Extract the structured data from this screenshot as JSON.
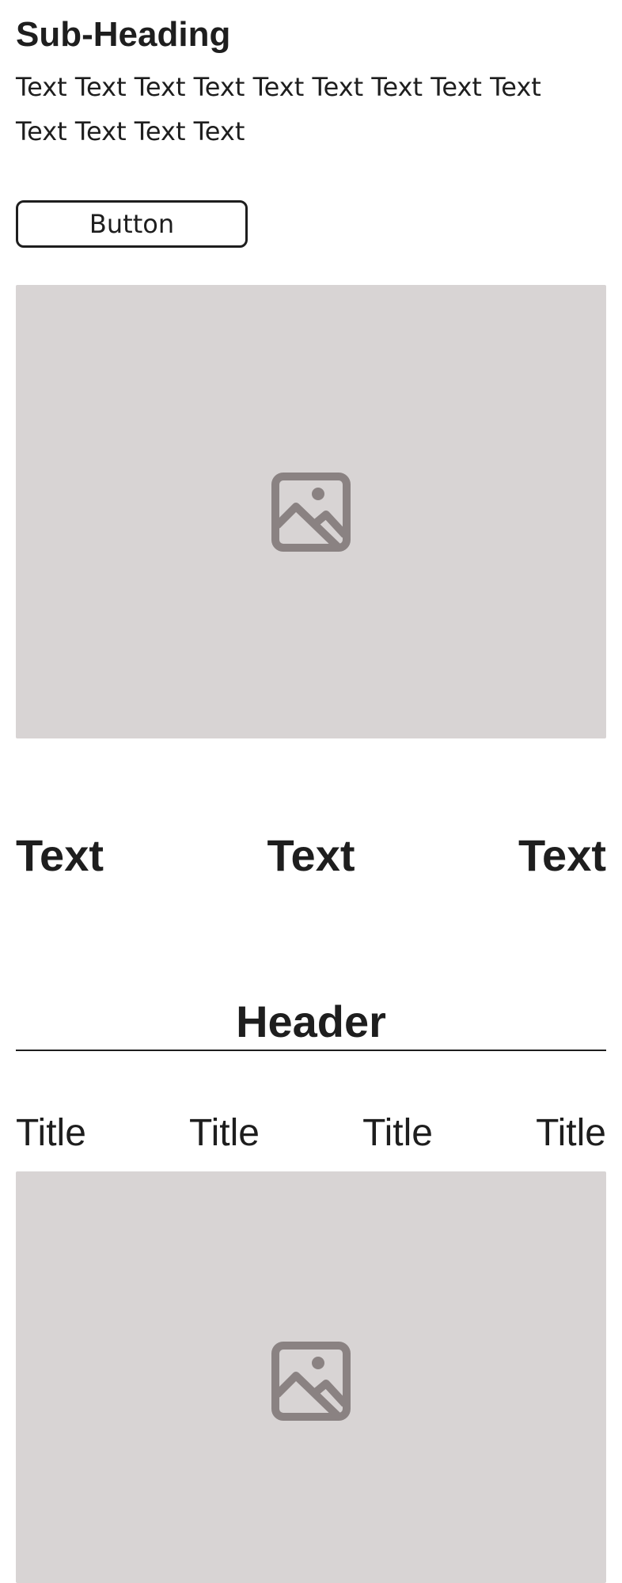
{
  "section": {
    "subheading": "Sub-Heading",
    "body": "Text Text Text Text Text Text Text Text Text Text Text Text Text",
    "button_label": "Button"
  },
  "image_placeholder_icon": "image-icon",
  "text_row": [
    "Text",
    "Text",
    "Text"
  ],
  "header": "Header",
  "tabs": [
    "Title",
    "Title",
    "Title",
    "Title"
  ],
  "colors": {
    "text": "#1e1e1e",
    "placeholder_bg": "#d8d4d4",
    "placeholder_icon": "#8a8282",
    "background": "#ffffff"
  }
}
